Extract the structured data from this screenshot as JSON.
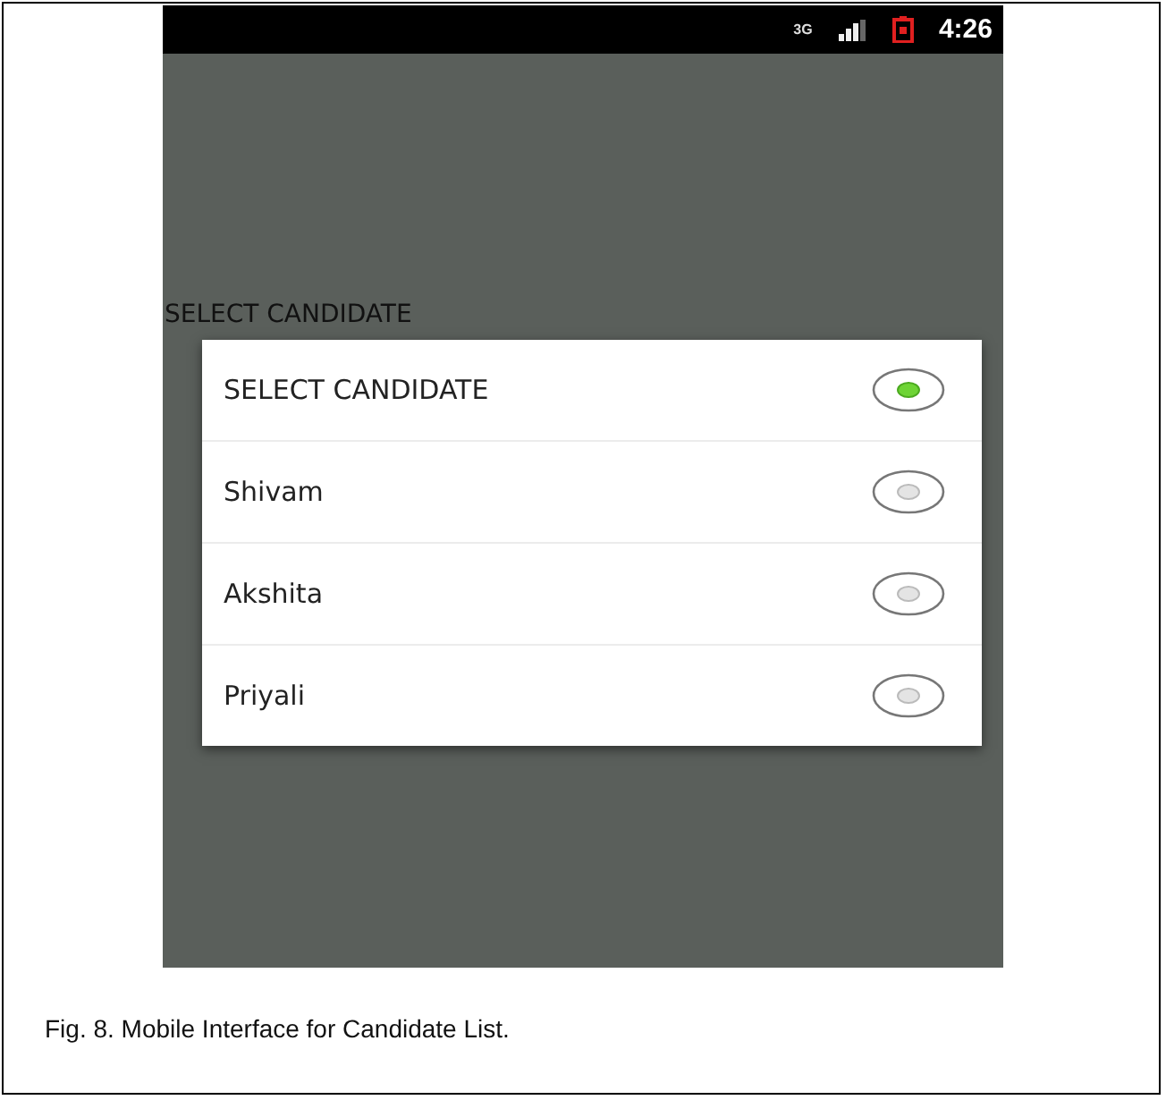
{
  "status_bar": {
    "network": "3G",
    "time": "4:26"
  },
  "label": "SELECT CANDIDATE",
  "options": [
    {
      "label": "SELECT CANDIDATE",
      "selected": true
    },
    {
      "label": "Shivam",
      "selected": false
    },
    {
      "label": "Akshita",
      "selected": false
    },
    {
      "label": "Priyali",
      "selected": false
    }
  ],
  "caption": "Fig. 8. Mobile Interface for Candidate List."
}
